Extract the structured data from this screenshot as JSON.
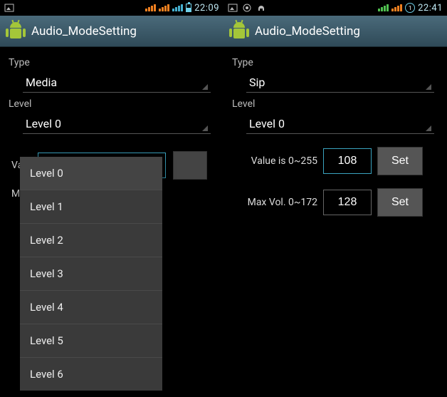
{
  "left": {
    "statusbar": {
      "clock": "22:09"
    },
    "appbar": {
      "title": "Audio_ModeSetting"
    },
    "type_label": "Type",
    "type_value": "Media",
    "level_label": "Level",
    "level_value": "Level 0",
    "value_label_short": "Valu",
    "max_label_short": "Max",
    "dropdown": {
      "items": [
        "Level 0",
        "Level 1",
        "Level 2",
        "Level 3",
        "Level 4",
        "Level 5",
        "Level 6"
      ]
    }
  },
  "right": {
    "statusbar": {
      "clock": "22:41"
    },
    "appbar": {
      "title": "Audio_ModeSetting"
    },
    "type_label": "Type",
    "type_value": "Sip",
    "level_label": "Level",
    "level_value": "Level 0",
    "value_row": {
      "label": "Value is 0~255",
      "value": "108",
      "button": "Set"
    },
    "max_row": {
      "label": "Max Vol. 0~172",
      "value": "128",
      "button": "Set"
    }
  }
}
